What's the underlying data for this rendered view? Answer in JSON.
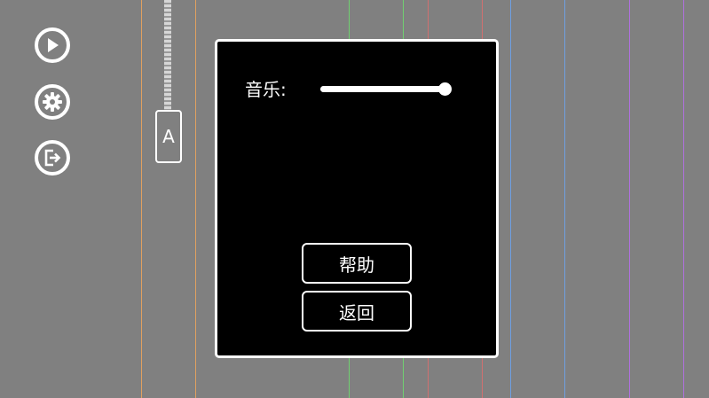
{
  "colors": {
    "background": "#808080",
    "dialog_bg": "#000000",
    "foreground": "#ffffff",
    "lane_orange": "#e0a060",
    "lane_green": "#70d070",
    "lane_red": "#d07070",
    "lane_blue": "#6f9fe0",
    "lane_purple": "#b070e0"
  },
  "sidebar": {
    "buttons": [
      {
        "icon": "play-icon"
      },
      {
        "icon": "gear-icon"
      },
      {
        "icon": "exit-icon"
      }
    ]
  },
  "zipper": {
    "label": "A"
  },
  "settings": {
    "music_label": "音乐:",
    "music_volume": 1.0,
    "help_label": "帮助",
    "back_label": "返回"
  }
}
